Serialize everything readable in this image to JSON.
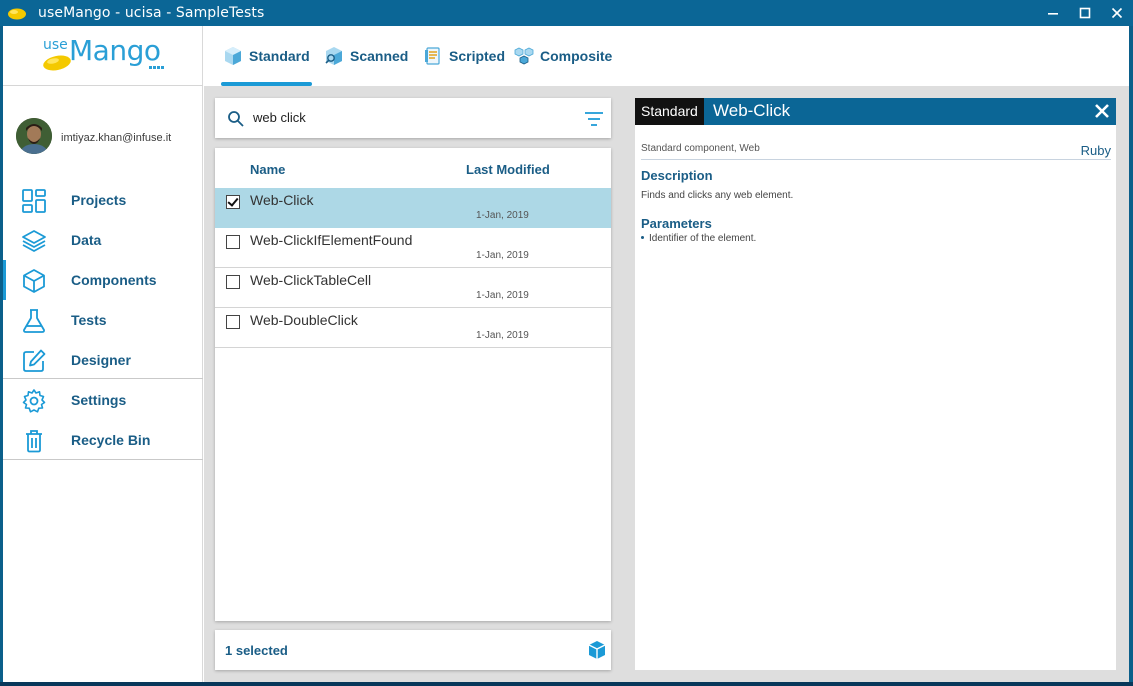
{
  "window": {
    "title": "useMango - ucisa - SampleTests",
    "controls": [
      "minimize-icon",
      "maximize-icon",
      "close-icon"
    ]
  },
  "logo": {
    "use": "use",
    "mango": "Mango"
  },
  "user": {
    "email": "imtiyaz.khan@infuse.it"
  },
  "sidebar": {
    "items": [
      {
        "label": "Projects",
        "icon": "grid-icon"
      },
      {
        "label": "Data",
        "icon": "layers-icon"
      },
      {
        "label": "Components",
        "icon": "cube-icon",
        "active": true
      },
      {
        "label": "Tests",
        "icon": "flask-icon"
      },
      {
        "label": "Designer",
        "icon": "pencil-box-icon"
      },
      {
        "label": "Settings",
        "icon": "gear-icon"
      },
      {
        "label": "Recycle Bin",
        "icon": "trash-icon"
      }
    ]
  },
  "tabs": [
    {
      "label": "Standard",
      "icon": "standard-cube-icon",
      "active": true
    },
    {
      "label": "Scanned",
      "icon": "scanned-cube-icon"
    },
    {
      "label": "Scripted",
      "icon": "scripted-doc-icon"
    },
    {
      "label": "Composite",
      "icon": "composite-cubes-icon"
    }
  ],
  "search": {
    "value": "web click"
  },
  "list": {
    "columns": {
      "name": "Name",
      "modified": "Last Modified"
    },
    "rows": [
      {
        "name": "Web-Click",
        "date": "1-Jan, 2019",
        "checked": true
      },
      {
        "name": "Web-ClickIfElementFound",
        "date": "1-Jan, 2019",
        "checked": false
      },
      {
        "name": "Web-ClickTableCell",
        "date": "1-Jan, 2019",
        "checked": false
      },
      {
        "name": "Web-DoubleClick",
        "date": "1-Jan, 2019",
        "checked": false
      }
    ]
  },
  "footer": {
    "selected": "1 selected"
  },
  "detail": {
    "chip": "Standard",
    "title": "Web-Click",
    "subtitle": "Standard component, Web",
    "language": "Ruby",
    "description_heading": "Description",
    "description": "Finds and clicks any web element.",
    "parameters_heading": "Parameters",
    "parameters": [
      "Identifier of the element."
    ]
  },
  "colors": {
    "primary": "#0b6696",
    "accent": "#1b9ad6",
    "text": "#1a5d86",
    "selected_row": "#add8e6"
  }
}
